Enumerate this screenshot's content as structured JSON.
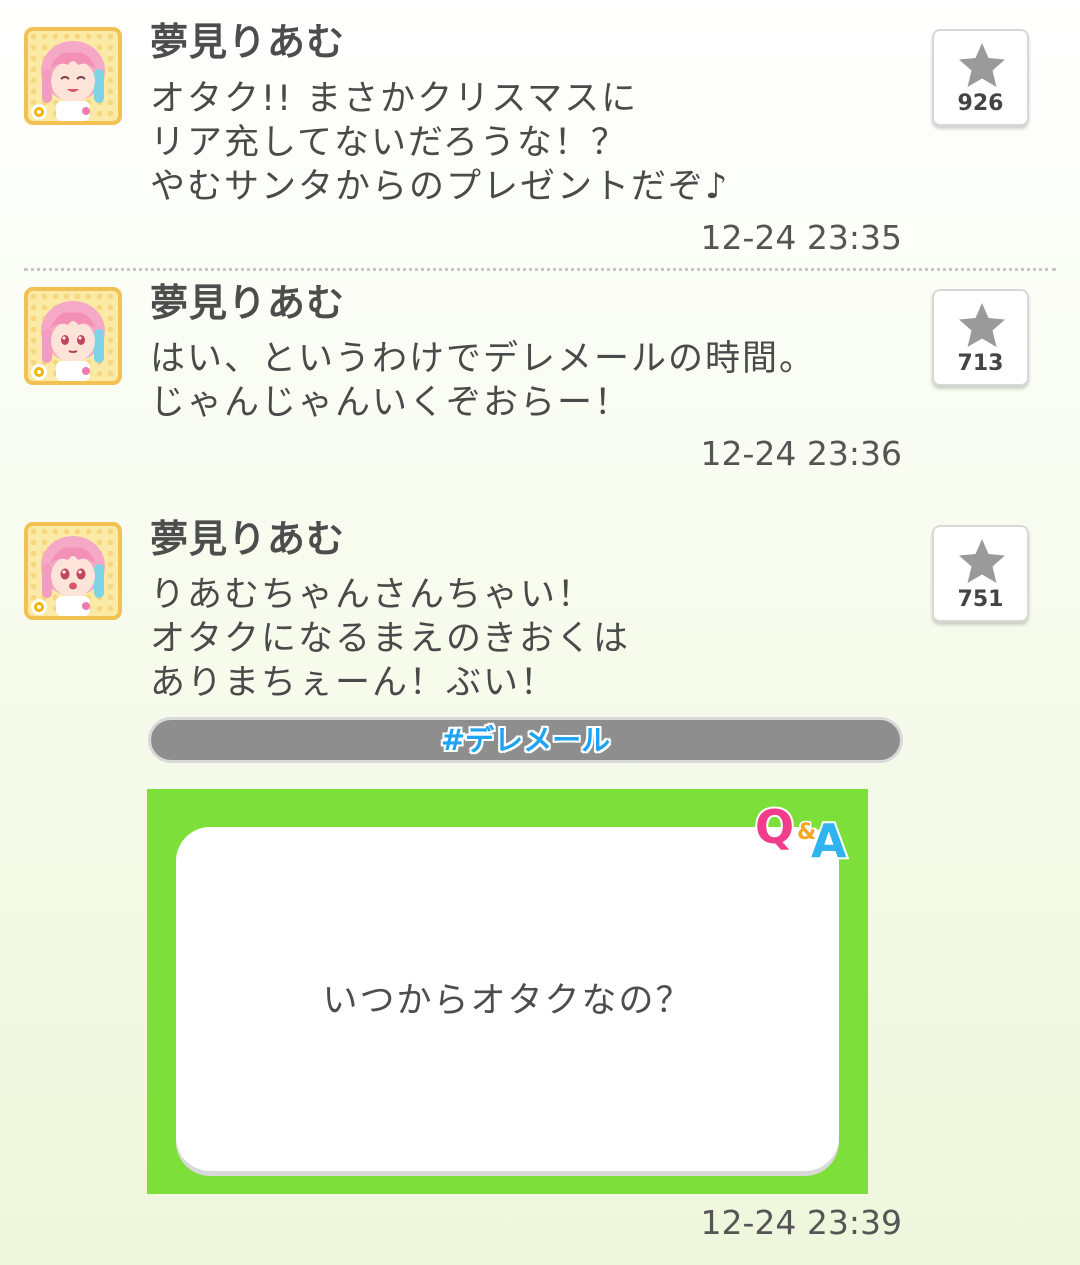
{
  "posts": [
    {
      "author": "夢見りあむ",
      "lines": [
        "オタク!! まさかクリスマスに",
        "リア充してないだろうな！？",
        "やむサンタからのプレゼントだぞ♪"
      ],
      "timestamp": "12-24 23:35",
      "fav_count": "926",
      "avatar_expression": "smiling-closed-eyes"
    },
    {
      "author": "夢見りあむ",
      "lines": [
        "はい、というわけでデレメールの時間。",
        "じゃんじゃんいくぞおらー！"
      ],
      "timestamp": "12-24 23:36",
      "fav_count": "713",
      "avatar_expression": "calm"
    },
    {
      "author": "夢見りあむ",
      "lines": [
        "りあむちゃんさんちゃい！",
        "オタクになるまえのきおくは",
        "ありまちぇーん！ぶい！"
      ],
      "hashtag": "#デレメール",
      "qa_card": {
        "question": "いつからオタクなの？",
        "badge_q": "Q",
        "badge_amp": "&",
        "badge_a": "A"
      },
      "timestamp": "12-24 23:39",
      "fav_count": "751",
      "avatar_expression": "open-mouth"
    }
  ],
  "icons": {
    "favorite": "star-icon",
    "avatar_badge": "flower-icon"
  },
  "colors": {
    "avatar_border": "#f2c152",
    "hashtag_text": "#1fa3f2",
    "qa_card_bg": "#7ddf3a",
    "qa_badge_q": "#f23d8c",
    "qa_badge_a": "#2fb4f0"
  }
}
